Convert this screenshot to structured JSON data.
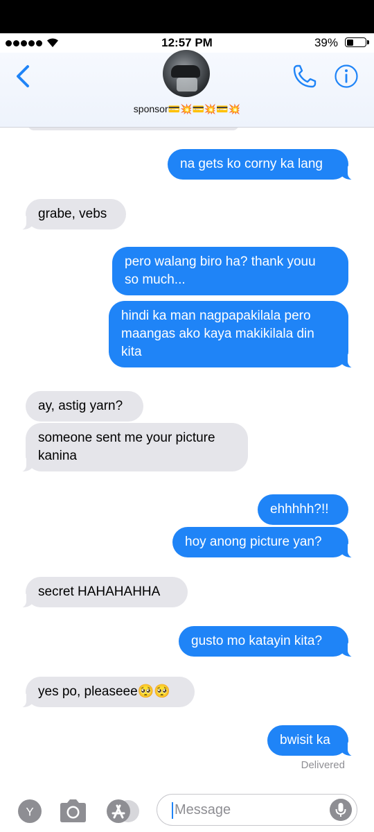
{
  "status_bar": {
    "time": "12:57 PM",
    "battery_percent": "39%",
    "battery_level": 0.39,
    "signal_bars": 5
  },
  "header": {
    "contact_name": "sponsor💳💥💳💥💳💥",
    "back_icon": "chevron-left-icon",
    "call_icon": "phone-icon",
    "info_icon": "info-icon",
    "accent_color": "#1f84f7"
  },
  "messages": [
    {
      "direction": "outgoing",
      "text": "na gets ko corny ka lang"
    },
    {
      "direction": "incoming",
      "text": "grabe, vebs"
    },
    {
      "direction": "outgoing",
      "lines": [
        "pero walang biro ha? thank youu",
        "so much..."
      ]
    },
    {
      "direction": "outgoing",
      "lines": [
        "hindi ka man nagpapakilala pero",
        "maangas ako kaya makikilala din",
        "kita"
      ]
    },
    {
      "direction": "incoming",
      "text": "ay, astig yarn?"
    },
    {
      "direction": "incoming",
      "lines": [
        "someone sent me your picture",
        "kanina"
      ]
    },
    {
      "direction": "outgoing",
      "text": "ehhhhh?!!"
    },
    {
      "direction": "outgoing",
      "text": "hoy anong picture yan?"
    },
    {
      "direction": "incoming",
      "text": "secret HAHAHAHHA"
    },
    {
      "direction": "outgoing",
      "text": "gusto mo katayin kita?"
    },
    {
      "direction": "incoming",
      "text": "yes po, pleaseee🥺🥺"
    },
    {
      "direction": "outgoing",
      "text": "bwisit ka"
    }
  ],
  "delivery_status": "Delivered",
  "input_bar": {
    "apps_button_letter": "Y",
    "camera_icon": "camera-icon",
    "appstore_icon": "app-store-icon",
    "message_placeholder": "Message",
    "mic_icon": "microphone-icon"
  },
  "colors": {
    "outgoing_bubble": "#1f84f7",
    "incoming_bubble": "#e5e5ea",
    "muted_text": "#8e8e93"
  }
}
